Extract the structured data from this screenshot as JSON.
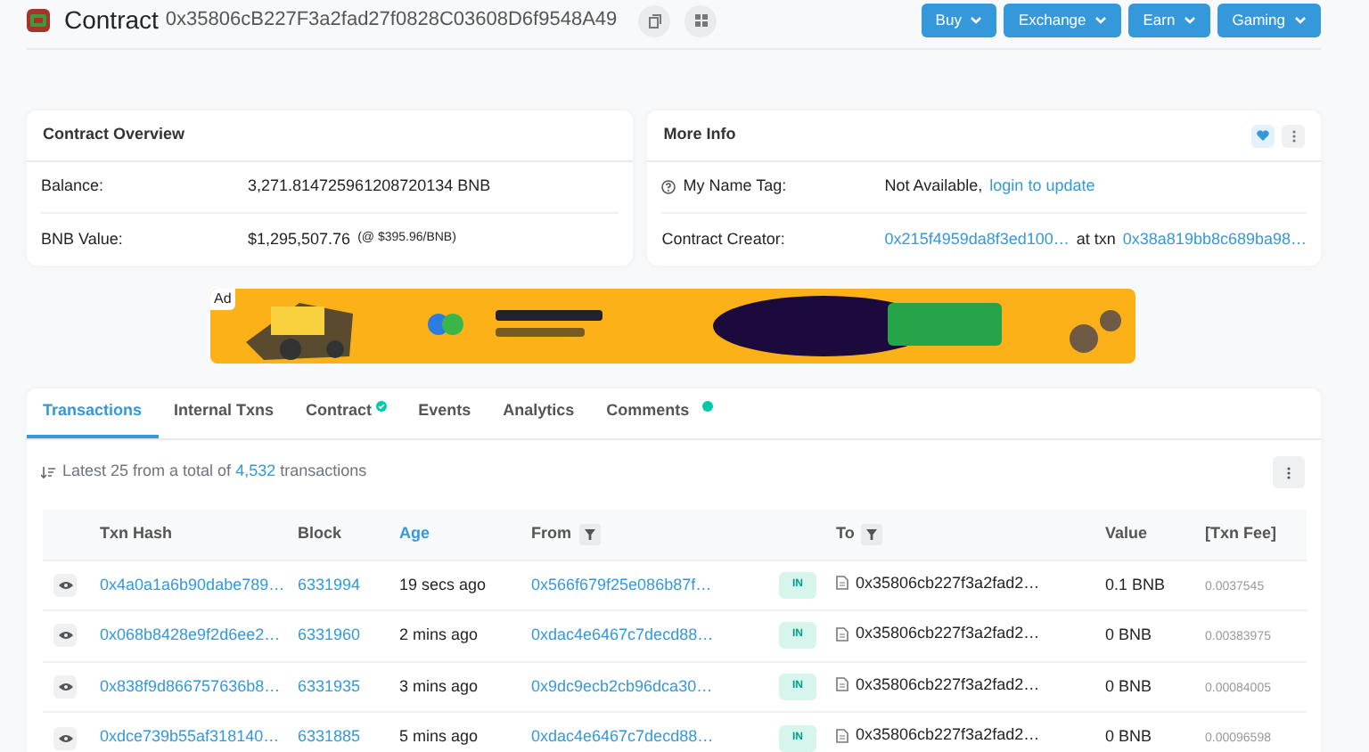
{
  "header": {
    "title": "Contract",
    "address": "0x35806cB227F3a2fad27f0828C03608D6f9548A49",
    "nav_buttons": [
      "Buy",
      "Exchange",
      "Earn",
      "Gaming"
    ]
  },
  "overview": {
    "title": "Contract Overview",
    "rows": [
      {
        "label": "Balance:",
        "value": "3,271.814725961208720134 BNB"
      },
      {
        "label": "BNB Value:",
        "value": "$1,295,507.76",
        "note": "(@ $395.96/BNB)"
      }
    ]
  },
  "more_info": {
    "title": "More Info",
    "name_tag": {
      "label": "My Name Tag:",
      "value": "Not Available,",
      "link": "login to update"
    },
    "creator": {
      "label": "Contract Creator:",
      "address": "0x215f4959da8f3ed100…",
      "connector": "at txn",
      "txn": "0x38a819bb8c689ba98…"
    }
  },
  "ad": {
    "label": "Ad",
    "kind": "picture"
  },
  "tabs": [
    {
      "label": "Transactions",
      "selected": true
    },
    {
      "label": "Internal Txns",
      "selected": false
    },
    {
      "label": "Contract",
      "selected": false,
      "kind": "check"
    },
    {
      "label": "Events",
      "selected": false
    },
    {
      "label": "Analytics",
      "selected": false
    },
    {
      "label": "Comments",
      "selected": false,
      "kind": "dot"
    }
  ],
  "summary": {
    "prefix": "Latest 25 from a total of",
    "count": "4,532",
    "suffix": "transactions"
  },
  "table": {
    "columns": [
      {
        "label": "Txn Hash",
        "sorted": false,
        "filter": false
      },
      {
        "label": "Block",
        "sorted": false,
        "filter": false
      },
      {
        "label": "Age",
        "sorted": true,
        "filter": false
      },
      {
        "label": "From",
        "sorted": false,
        "filter": true
      },
      {
        "label": "To",
        "sorted": false,
        "filter": true
      },
      {
        "label": "Value",
        "sorted": false,
        "filter": false
      },
      {
        "label": "[Txn Fee]",
        "sorted": false,
        "filter": false
      }
    ],
    "rows": [
      {
        "hash": "0x4a0a1a6b90dabe789…",
        "block": "6331994",
        "age": "19 secs ago",
        "from": "0x566f679f25e086b87f…",
        "direction": "IN",
        "to": "0x35806cb227f3a2fad2…",
        "value": "0.1 BNB",
        "fee": "0.0037545"
      },
      {
        "hash": "0x068b8428e9f2d6ee2…",
        "block": "6331960",
        "age": "2 mins ago",
        "from": "0xdac4e6467c7decd88…",
        "direction": "IN",
        "to": "0x35806cb227f3a2fad2…",
        "value": "0 BNB",
        "fee": "0.00383975"
      },
      {
        "hash": "0x838f9d866757636b8…",
        "block": "6331935",
        "age": "3 mins ago",
        "from": "0x9dc9ecb2cb96dca30…",
        "direction": "IN",
        "to": "0x35806cb227f3a2fad2…",
        "value": "0 BNB",
        "fee": "0.00084005"
      },
      {
        "hash": "0xdce739b55af318140…",
        "block": "6331885",
        "age": "5 mins ago",
        "from": "0xdac4e6467c7decd88…",
        "direction": "IN",
        "to": "0x35806cb227f3a2fad2…",
        "value": "0 BNB",
        "fee": "0.00096598"
      }
    ]
  }
}
